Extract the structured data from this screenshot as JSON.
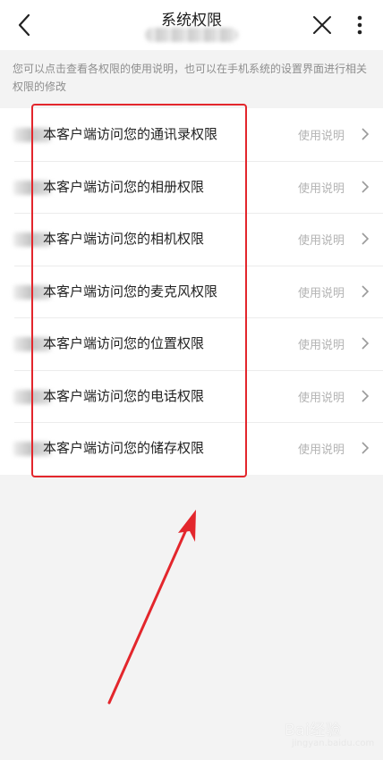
{
  "header": {
    "title": "系统权限",
    "icons": {
      "back": "chevron-left-icon",
      "close": "close-icon",
      "more": "more-vertical-icon"
    }
  },
  "notice": "您可以点击查看各权限的使用说明，也可以在手机系统的设置界面进行相关权限的修改",
  "permissions": [
    {
      "label": "本客户端访问您的通讯录权限",
      "help": "使用说明"
    },
    {
      "label": "本客户端访问您的相册权限",
      "help": "使用说明"
    },
    {
      "label": "本客户端访问您的相机权限",
      "help": "使用说明"
    },
    {
      "label": "本客户端访问您的麦克风权限",
      "help": "使用说明"
    },
    {
      "label": "本客户端访问您的位置权限",
      "help": "使用说明"
    },
    {
      "label": "本客户端访问您的电话权限",
      "help": "使用说明"
    },
    {
      "label": "本客户端访问您的储存权限",
      "help": "使用说明"
    }
  ],
  "annotation": {
    "color": "#e3262c"
  },
  "watermark": {
    "text": "Bai经验",
    "sub": "jingyan.baidu.com"
  }
}
